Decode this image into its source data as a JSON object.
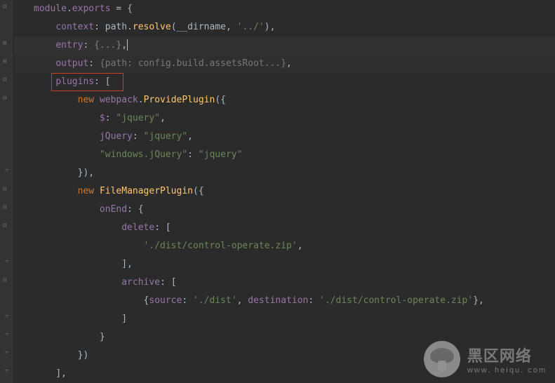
{
  "code": {
    "l1": {
      "module": "module",
      "dot": ".",
      "exports": "exports",
      "eq": " = {"
    },
    "l2": {
      "ind": "    ",
      "key": "context",
      "c": ": ",
      "path": "path",
      "d": ".",
      "fn": "resolve",
      "open": "(",
      "arg1": "__dirname",
      "comma": ", ",
      "str": "'../'",
      "close": "),"
    },
    "l3": {
      "ind": "    ",
      "key": "entry",
      "c": ": ",
      "fold": "{...}",
      "end": ","
    },
    "l4": {
      "ind": "    ",
      "key": "output",
      "c": ": ",
      "fold": "{path: config.build.assetsRoot...}",
      "end": ","
    },
    "l5": {
      "ind": "    ",
      "key": "plugins",
      "c": ": ",
      "open": "["
    },
    "l6": {
      "ind": "        ",
      "new": "new ",
      "obj": "webpack",
      "d": ".",
      "fn": "ProvidePlugin",
      "open": "({"
    },
    "l7": {
      "ind": "            ",
      "key": "$",
      "c": ": ",
      "str": "\"jquery\"",
      "end": ","
    },
    "l8": {
      "ind": "            ",
      "key": "jQuery",
      "c": ": ",
      "str": "\"jquery\"",
      "end": ","
    },
    "l9": {
      "ind": "            ",
      "key": "\"windows.jQuery\"",
      "c": ": ",
      "str": "\"jquery\""
    },
    "l10": {
      "ind": "        ",
      "close": "}),"
    },
    "l11": {
      "ind": "        ",
      "new": "new ",
      "fn": "FileManagerPlugin",
      "open": "({"
    },
    "l12": {
      "ind": "            ",
      "key": "onEnd",
      "c": ": ",
      "open": "{"
    },
    "l13": {
      "ind": "                ",
      "key": "delete",
      "c": ": ",
      "open": "["
    },
    "l14": {
      "ind": "                    ",
      "str": "'./dist/control-operate.zip'",
      "end": ","
    },
    "l15": {
      "ind": "                ",
      "close": "],"
    },
    "l16": {
      "ind": "                ",
      "key": "archive",
      "c": ": ",
      "open": "["
    },
    "l17": {
      "ind": "                    ",
      "open": "{",
      "k1": "source",
      "c1": ": ",
      "s1": "'./dist'",
      "comma": ", ",
      "k2": "destination",
      "c2": ": ",
      "s2": "'./dist/control-operate.zip'",
      "close": "},"
    },
    "l18": {
      "ind": "                ",
      "close": "]"
    },
    "l19": {
      "ind": "            ",
      "close": "}"
    },
    "l20": {
      "ind": "        ",
      "close": "})"
    },
    "l21": {
      "ind": "    ",
      "close": "],"
    }
  },
  "watermark": {
    "title": "黑区网络",
    "url": "www. heiqu. com"
  },
  "icons": {
    "bulb": "bulb-icon"
  }
}
